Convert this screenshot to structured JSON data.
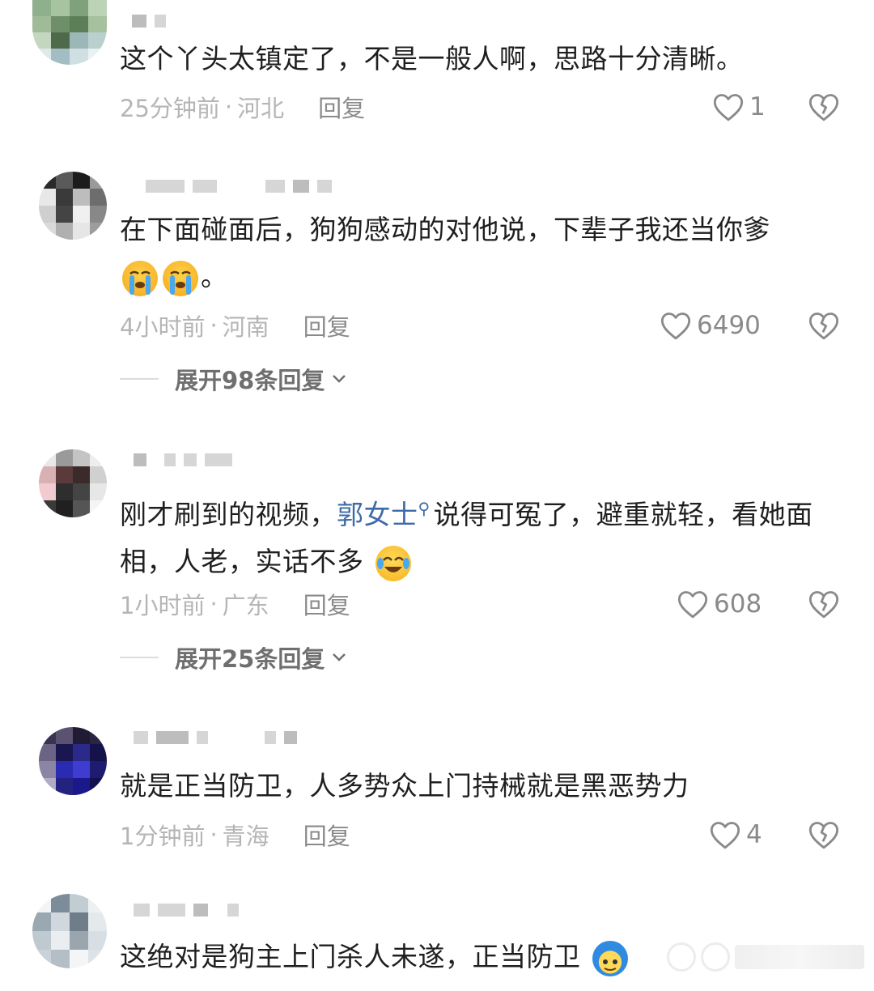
{
  "comments": [
    {
      "text": "这个丫头太镇定了，不是一般人啊，思路十分清晰。",
      "time": "25分钟前",
      "sep": "·",
      "location": "河北",
      "reply_label": "回复",
      "likes": "1"
    },
    {
      "text_a": "在下面碰面后，狗狗感动的对他说，下辈子我还当你爹",
      "text_b": "。",
      "time": "4小时前",
      "sep": "·",
      "location": "河南",
      "reply_label": "回复",
      "likes": "6490",
      "expand_label": "展开98条回复"
    },
    {
      "text_a": "刚才刷到的视频，",
      "link": "郭女士",
      "text_b": "说得可冤了，避重就轻，看她面相，人老，实话不多",
      "time": "1小时前",
      "sep": "·",
      "location": "广东",
      "reply_label": "回复",
      "likes": "608",
      "expand_label": "展开25条回复"
    },
    {
      "text": "就是正当防卫，人多势众上门持械就是黑恶势力",
      "time": "1分钟前",
      "sep": "·",
      "location": "青海",
      "reply_label": "回复",
      "likes": "4"
    },
    {
      "text": "这绝对是狗主上门杀人未遂，正当防卫"
    }
  ],
  "icons": {
    "like": "heart-outline-icon",
    "dislike": "broken-heart-icon",
    "expand": "chevron-down-icon",
    "link": "search-icon",
    "emoji_cry": "loudly-crying-face-icon",
    "emoji_laugh": "tears-of-joy-icon"
  },
  "colors": {
    "link": "#3d6aa8",
    "meta": "#b5b5b5",
    "reply": "#8a8a8a"
  }
}
